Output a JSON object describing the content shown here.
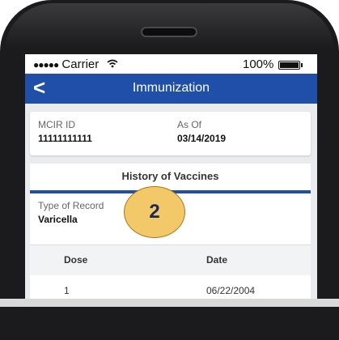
{
  "status_bar": {
    "carrier": "Carrier",
    "signal": "●●●●●",
    "battery": "100%"
  },
  "nav": {
    "back_icon": "chevron-left-icon",
    "back_glyph": "<",
    "title": "Immunization"
  },
  "patient": {
    "mcir_label": "MCIR ID",
    "mcir_value": "11111111111",
    "asof_label": "As Of",
    "asof_value": "03/14/2019"
  },
  "history": {
    "title": "History of Vaccines",
    "record_label": "Type of Record",
    "record_value": "Varicella",
    "collapse_glyph": "^",
    "columns": [
      "Dose",
      "Date"
    ],
    "rows": [
      {
        "dose": "1",
        "date": "06/22/2004"
      }
    ]
  },
  "annotation": {
    "badge": "2",
    "color": "#f3c869"
  },
  "colors": {
    "primary": "#1f4fa8",
    "background": "#e9ebee"
  }
}
